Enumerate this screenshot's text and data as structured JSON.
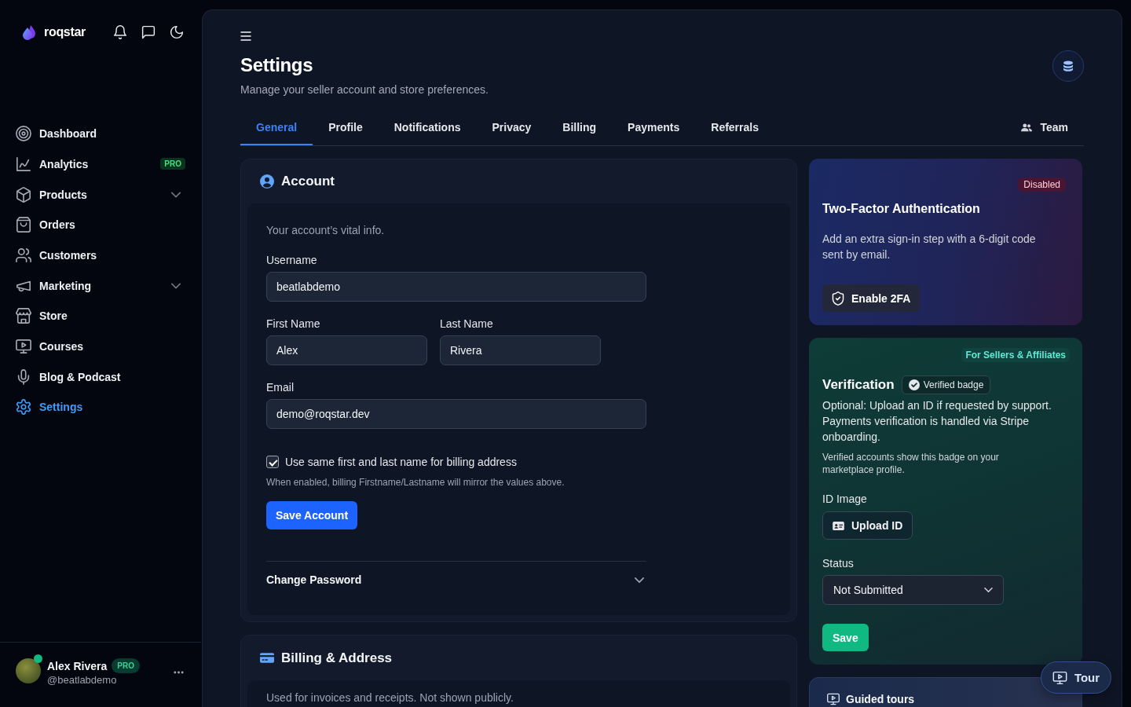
{
  "sidebar": {
    "brand": "roqstar",
    "nav": [
      {
        "label": "Dashboard",
        "kind": "link",
        "selected": false
      },
      {
        "label": "Analytics",
        "kind": "link",
        "selected": false,
        "badge": "PRO"
      },
      {
        "label": "Products",
        "kind": "group",
        "selected": false,
        "expanded": false
      },
      {
        "label": "Orders",
        "kind": "link",
        "selected": false
      },
      {
        "label": "Customers",
        "kind": "link",
        "selected": false
      },
      {
        "label": "Marketing",
        "kind": "group",
        "selected": false,
        "expanded": false
      },
      {
        "label": "Store",
        "kind": "link",
        "selected": false
      },
      {
        "label": "Courses",
        "kind": "link",
        "selected": false
      },
      {
        "label": "Blog & Podcast",
        "kind": "link",
        "selected": false
      },
      {
        "label": "Settings",
        "kind": "link",
        "selected": true
      }
    ],
    "user": {
      "name": "Alex Rivera",
      "badge": "PRO",
      "handle": "@beatlabdemo",
      "online": true
    }
  },
  "page": {
    "title": "Settings",
    "subtitle": "Manage your seller account and store preferences."
  },
  "tabs": [
    {
      "label": "General",
      "selected": true
    },
    {
      "label": "Profile",
      "selected": false
    },
    {
      "label": "Notifications",
      "selected": false
    },
    {
      "label": "Privacy",
      "selected": false
    },
    {
      "label": "Billing",
      "selected": false
    },
    {
      "label": "Payments",
      "selected": false
    },
    {
      "label": "Referrals",
      "selected": false
    }
  ],
  "team_link": {
    "label": "Team"
  },
  "account": {
    "title": "Account",
    "intro": "Your account’s vital info.",
    "field_rows": [
      {
        "fields": [
          {
            "label": "Username",
            "value": "beatlabdemo"
          }
        ]
      },
      {
        "fields": [
          {
            "label": "First Name",
            "value": "Alex"
          },
          {
            "label": "Last Name",
            "value": "Rivera"
          }
        ]
      },
      {
        "fields": [
          {
            "label": "Email",
            "value": "demo@roqstar.dev"
          }
        ]
      }
    ],
    "billing_checkbox": {
      "label": "Use same first and last name for billing address",
      "checked": true,
      "hint": "When enabled, billing Firstname/Lastname will mirror the values above."
    },
    "save_button": "Save Account",
    "change_password": {
      "label": "Change Password",
      "expanded": false
    }
  },
  "billing": {
    "title": "Billing & Address",
    "intro": "Used for invoices and receipts. Not shown publicly."
  },
  "two_factor": {
    "enabled": false,
    "status": "Disabled",
    "title": "Two-Factor Authentication",
    "description": "Add an extra sign-in step with a 6-digit code sent by email.",
    "button": "Enable 2FA"
  },
  "verification": {
    "tag": "For Sellers & Affiliates",
    "title": "Verification",
    "badge": "Verified badge",
    "description": "Optional: Upload an ID if requested by support. Payments verification is handled via Stripe onboarding.",
    "note": "Verified accounts show this badge on your marketplace profile.",
    "id_label": "ID Image",
    "upload_button": "Upload ID",
    "status_label": "Status",
    "status_value": "Not Submitted",
    "save_button": "Save"
  },
  "guided_tours": {
    "title": "Guided tours"
  },
  "tour_button": {
    "label": "Tour"
  }
}
